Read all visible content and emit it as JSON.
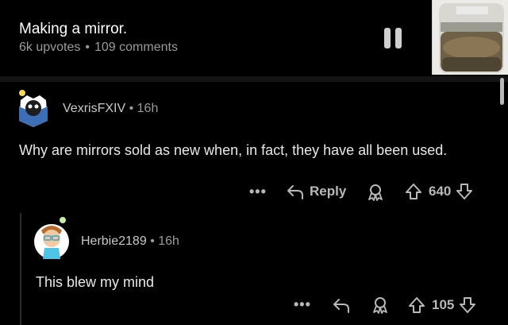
{
  "post": {
    "title": "Making a mirror.",
    "upvotes": "6k upvotes",
    "comments": "109 comments"
  },
  "comments": [
    {
      "username": "VexrisFXIV",
      "time": "16h",
      "text": "Why are mirrors sold as new when, in fact, they have all been used.",
      "reply_label": "Reply",
      "score": "640",
      "more": "•••"
    },
    {
      "username": "Herbie2189",
      "time": "16h",
      "text": "This blew my mind",
      "score": "105",
      "more": "•••"
    }
  ],
  "separator": "•",
  "colors": {
    "background": "#000000",
    "text": "#d7dadc",
    "muted": "#9a9a9a"
  },
  "icons": [
    "pause-icon",
    "reply-icon",
    "award-icon",
    "upvote-icon",
    "downvote-icon",
    "more-icon"
  ]
}
